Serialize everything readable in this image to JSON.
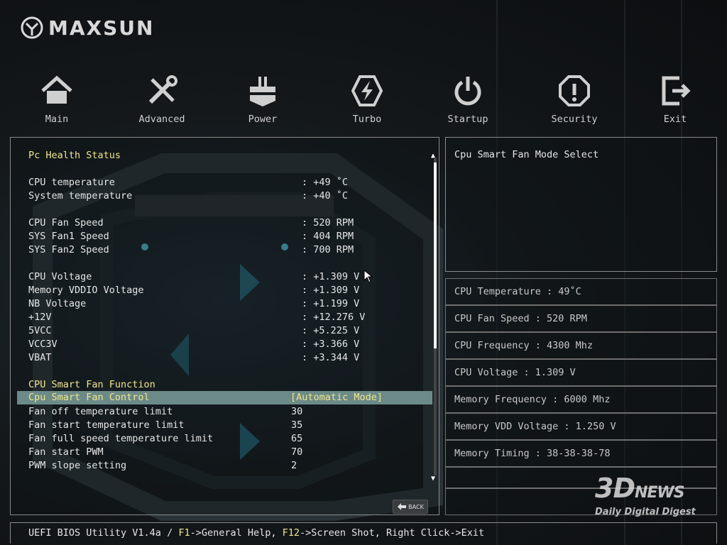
{
  "brand": {
    "name": "MAXSUN"
  },
  "nav": [
    {
      "label": "Main",
      "icon": "home-icon"
    },
    {
      "label": "Advanced",
      "icon": "tools-icon"
    },
    {
      "label": "Power",
      "icon": "power-chip-icon"
    },
    {
      "label": "Turbo",
      "icon": "turbo-bolt-icon"
    },
    {
      "label": "Startup",
      "icon": "power-button-icon"
    },
    {
      "label": "Security",
      "icon": "shield-octagon-icon"
    },
    {
      "label": "Exit",
      "icon": "exit-icon"
    }
  ],
  "left": {
    "section_title": "Pc Health Status",
    "temps": [
      {
        "label": "CPU temperature",
        "value": ": +49 ˚C"
      },
      {
        "label": "System temperature",
        "value": ": +40 ˚C"
      }
    ],
    "fans": [
      {
        "label": "CPU Fan Speed",
        "value": ": 520 RPM"
      },
      {
        "label": "SYS Fan1 Speed",
        "value": ": 404 RPM"
      },
      {
        "label": "SYS Fan2 Speed",
        "value": ": 700 RPM"
      }
    ],
    "voltages": [
      {
        "label": "CPU Voltage",
        "value": ": +1.309 V"
      },
      {
        "label": "Memory VDDIO Voltage",
        "value": ": +1.309 V"
      },
      {
        "label": "NB Voltage",
        "value": ": +1.199 V"
      },
      {
        "label": "+12V",
        "value": ": +12.276 V"
      },
      {
        "label": "5VCC",
        "value": ": +5.225 V"
      },
      {
        "label": "VCC3V",
        "value": ": +3.366 V"
      },
      {
        "label": "VBAT",
        "value": ": +3.344 V"
      }
    ],
    "fan_function_title": "CPU Smart Fan Function",
    "fan_control": {
      "label": "Cpu Smart Fan Control",
      "value": "[Automatic Mode]"
    },
    "fan_settings": [
      {
        "label": "Fan off temperature limit",
        "value": "30"
      },
      {
        "label": "Fan start temperature limit",
        "value": "35"
      },
      {
        "label": "Fan full speed temperature limit",
        "value": "65"
      },
      {
        "label": "Fan start PWM",
        "value": "70"
      },
      {
        "label": "PWM slope setting",
        "value": "2"
      }
    ],
    "back_label": "BACK"
  },
  "help": {
    "text": "Cpu Smart Fan Mode Select"
  },
  "info": [
    "CPU Temperature : 49˚C",
    "CPU Fan Speed : 520 RPM",
    "CPU Frequency : 4300 Mhz",
    "CPU Voltage : 1.309 V",
    "Memory Frequency : 6000 Mhz",
    "Memory VDD Voltage : 1.250 V",
    "Memory Timing : 38-38-38-78",
    ""
  ],
  "footer": {
    "prefix": "UEFI BIOS Utility V1.4a / ",
    "f1_key": "F1",
    "f1_text": "->General Help, ",
    "f12_key": "F12",
    "f12_text": "->Screen Shot, Right Click->Exit"
  },
  "watermark": {
    "logo": "3D",
    "logo_small": "NEWS",
    "tagline": "Daily Digital Digest"
  },
  "colors": {
    "highlight_row": "#6c8a88",
    "accent_text": "#f0e68c",
    "border": "#8a8a8a"
  }
}
